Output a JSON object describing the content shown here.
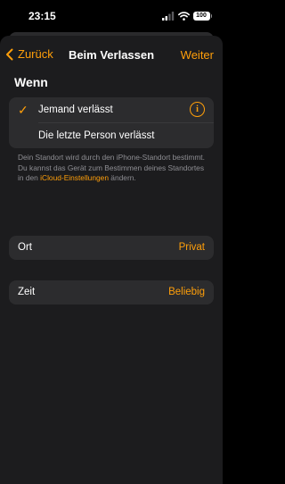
{
  "status": {
    "time": "23:15",
    "battery": "100"
  },
  "nav": {
    "back_label": "Zurück",
    "title": "Beim Verlassen",
    "next_label": "Weiter"
  },
  "when": {
    "header": "Wenn",
    "options": [
      {
        "label": "Jemand verlässt",
        "selected": true
      },
      {
        "label": "Die letzte Person verlässt",
        "selected": false
      }
    ],
    "footnote_text": "Dein Standort wird durch den iPhone-Standort bestimmt. Du kannst das Gerät zum Bestimmen deines Standortes in den ",
    "footnote_link": "iCloud-Einstellungen",
    "footnote_end": " ändern."
  },
  "location": {
    "label": "Ort",
    "value": "Privat"
  },
  "time_setting": {
    "label": "Zeit",
    "value": "Beliebig"
  },
  "colors": {
    "accent": "#ff9f0a",
    "background": "#1c1c1e",
    "cell": "#2c2c2e"
  }
}
